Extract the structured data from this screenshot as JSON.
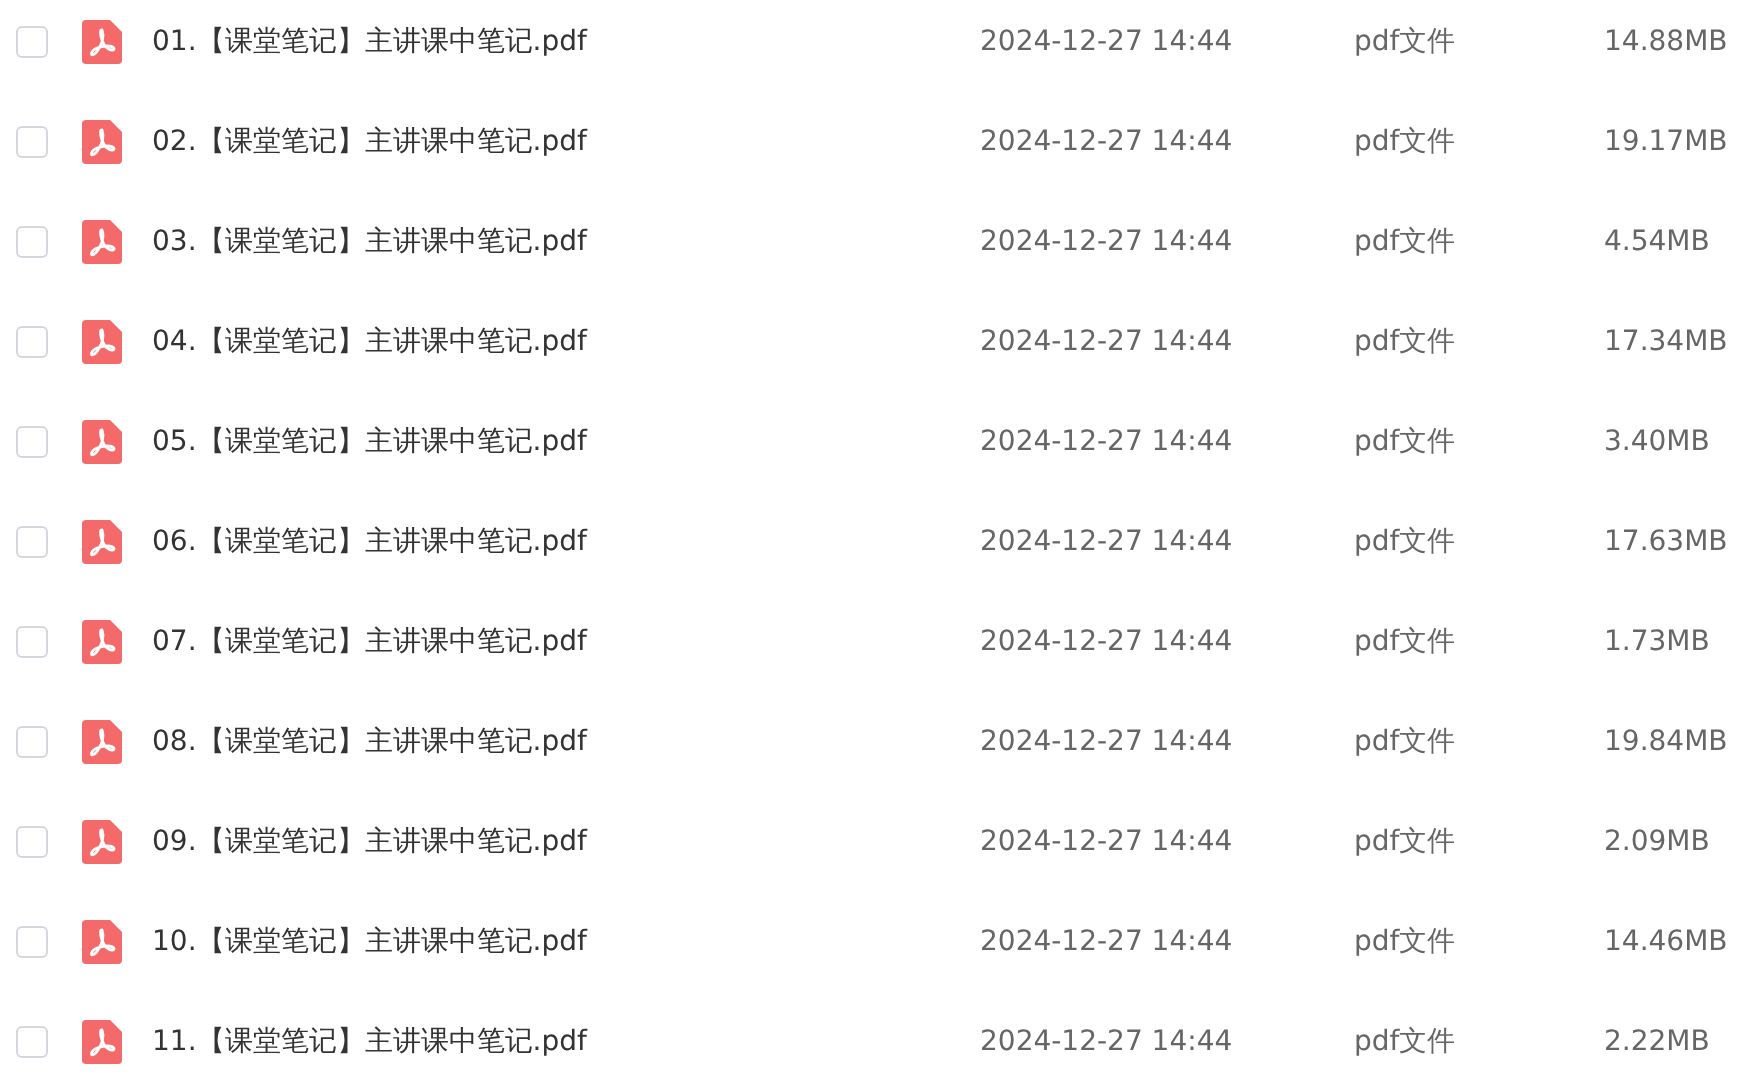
{
  "files": [
    {
      "name": "01.【课堂笔记】主讲课中笔记.pdf",
      "date": "2024-12-27 14:44",
      "type": "pdf文件",
      "size": "14.88MB",
      "checked": false
    },
    {
      "name": "02.【课堂笔记】主讲课中笔记.pdf",
      "date": "2024-12-27 14:44",
      "type": "pdf文件",
      "size": "19.17MB",
      "checked": false
    },
    {
      "name": "03.【课堂笔记】主讲课中笔记.pdf",
      "date": "2024-12-27 14:44",
      "type": "pdf文件",
      "size": "4.54MB",
      "checked": false
    },
    {
      "name": "04.【课堂笔记】主讲课中笔记.pdf",
      "date": "2024-12-27 14:44",
      "type": "pdf文件",
      "size": "17.34MB",
      "checked": false
    },
    {
      "name": "05.【课堂笔记】主讲课中笔记.pdf",
      "date": "2024-12-27 14:44",
      "type": "pdf文件",
      "size": "3.40MB",
      "checked": false
    },
    {
      "name": "06.【课堂笔记】主讲课中笔记.pdf",
      "date": "2024-12-27 14:44",
      "type": "pdf文件",
      "size": "17.63MB",
      "checked": false
    },
    {
      "name": "07.【课堂笔记】主讲课中笔记.pdf",
      "date": "2024-12-27 14:44",
      "type": "pdf文件",
      "size": "1.73MB",
      "checked": false
    },
    {
      "name": "08.【课堂笔记】主讲课中笔记.pdf",
      "date": "2024-12-27 14:44",
      "type": "pdf文件",
      "size": "19.84MB",
      "checked": false
    },
    {
      "name": "09.【课堂笔记】主讲课中笔记.pdf",
      "date": "2024-12-27 14:44",
      "type": "pdf文件",
      "size": "2.09MB",
      "checked": false
    },
    {
      "name": "10.【课堂笔记】主讲课中笔记.pdf",
      "date": "2024-12-27 14:44",
      "type": "pdf文件",
      "size": "14.46MB",
      "checked": false
    },
    {
      "name": "11.【课堂笔记】主讲课中笔记.pdf",
      "date": "2024-12-27 14:44",
      "type": "pdf文件",
      "size": "2.22MB",
      "checked": false
    }
  ]
}
